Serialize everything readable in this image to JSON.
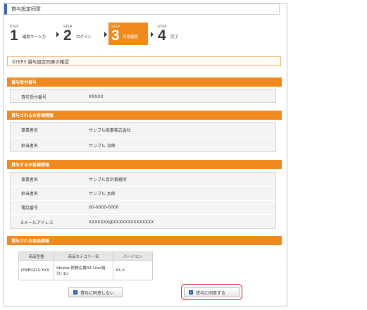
{
  "header": {
    "title": "貸与設定同意"
  },
  "steps": [
    {
      "tag": "STEP",
      "num": "1",
      "label": "確認キー入力"
    },
    {
      "tag": "STEP",
      "num": "2",
      "label": "ログイン"
    },
    {
      "tag": "STEP",
      "num": "3",
      "label": "同意確認"
    },
    {
      "tag": "STEP",
      "num": "4",
      "label": "完了"
    }
  ],
  "section_title": "STEP3 貸与設定同意の確認",
  "loan_number": {
    "heading": "貸与受付番号",
    "rows": [
      {
        "label": "貸与受付番号",
        "value": "XXXXX"
      }
    ]
  },
  "lent_customer": {
    "heading": "貸与されるお客様情報",
    "rows": [
      {
        "label": "事業者名",
        "value": "サンプル商事株式会社"
      },
      {
        "label": "担当者名",
        "value": "サンプル 次郎"
      }
    ]
  },
  "lending_customer": {
    "heading": "貸与するお客様情報",
    "rows": [
      {
        "label": "事業者名",
        "value": "サンプル会計事務所"
      },
      {
        "label": "担当者名",
        "value": "サンプル 太郎"
      },
      {
        "label": "電話番号",
        "value": "00-0000-0000"
      },
      {
        "label": "Eメールアドレス",
        "value": "XXXXXXX@XXXXXXXXXXXXXX"
      }
    ]
  },
  "product": {
    "heading": "貸与される商品情報",
    "columns": [
      "商品型番",
      "商品カテゴリー名",
      "バージョン"
    ],
    "rows": [
      {
        "model": "DWE0ZLS.XXX",
        "category": "Weplat 財務応援R4 Lite(組分) 1U",
        "version": "XX.X"
      }
    ]
  },
  "buttons": {
    "disagree": "貸与に同意しない",
    "agree": "貸与に同意する"
  },
  "colors": {
    "accent": "#f08a1e",
    "header_bar": "#3a62b0",
    "highlight": "#d41c1c"
  }
}
